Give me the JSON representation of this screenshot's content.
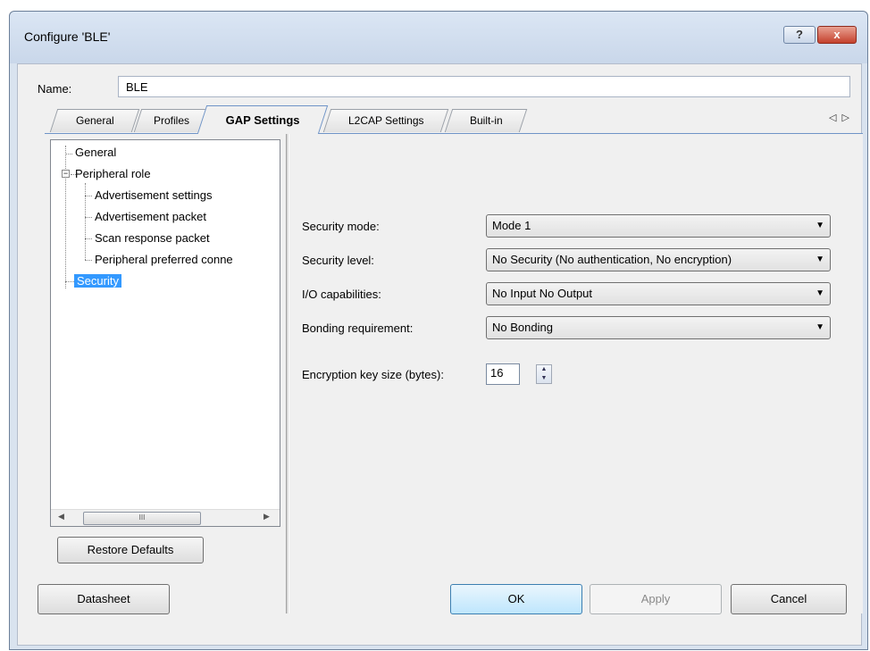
{
  "window": {
    "title": "Configure 'BLE'",
    "help_label": "?",
    "close_label": "x"
  },
  "name": {
    "label": "Name:",
    "value": "BLE"
  },
  "tabs": [
    {
      "label": "General"
    },
    {
      "label": "Profiles"
    },
    {
      "label": "GAP Settings",
      "active": true
    },
    {
      "label": "L2CAP Settings"
    },
    {
      "label": "Built-in"
    }
  ],
  "tab_scroll": {
    "left": "◁",
    "right": "▷"
  },
  "tree": {
    "items": [
      {
        "label": "General"
      },
      {
        "label": "Peripheral role",
        "expander": "−"
      },
      {
        "label": "Advertisement settings"
      },
      {
        "label": "Advertisement packet"
      },
      {
        "label": "Scan response packet"
      },
      {
        "label": "Peripheral preferred conne"
      },
      {
        "label": "Security",
        "selected": true
      }
    ],
    "scrollbar": {
      "left_arrow": "◀",
      "right_arrow": "▶",
      "thumb_grip": "III"
    }
  },
  "restore_defaults": "Restore Defaults",
  "form": {
    "security_mode": {
      "label": "Security mode:",
      "value": "Mode 1"
    },
    "security_level": {
      "label": "Security level:",
      "value": "No Security (No authentication, No encryption)"
    },
    "io_capabilities": {
      "label": "I/O capabilities:",
      "value": "No Input No Output"
    },
    "bonding": {
      "label": "Bonding requirement:",
      "value": "No Bonding"
    },
    "encryption_key_size": {
      "label": "Encryption key size (bytes):",
      "value": "16"
    },
    "dropdown_icon": "▼",
    "spin_up": "▲",
    "spin_down": "▼"
  },
  "buttons": {
    "datasheet": "Datasheet",
    "ok": "OK",
    "apply": "Apply",
    "cancel": "Cancel"
  },
  "colors": {
    "selection": "#3399ff",
    "tab_accent": "#6f94c7",
    "close_button": "#c4412d"
  }
}
